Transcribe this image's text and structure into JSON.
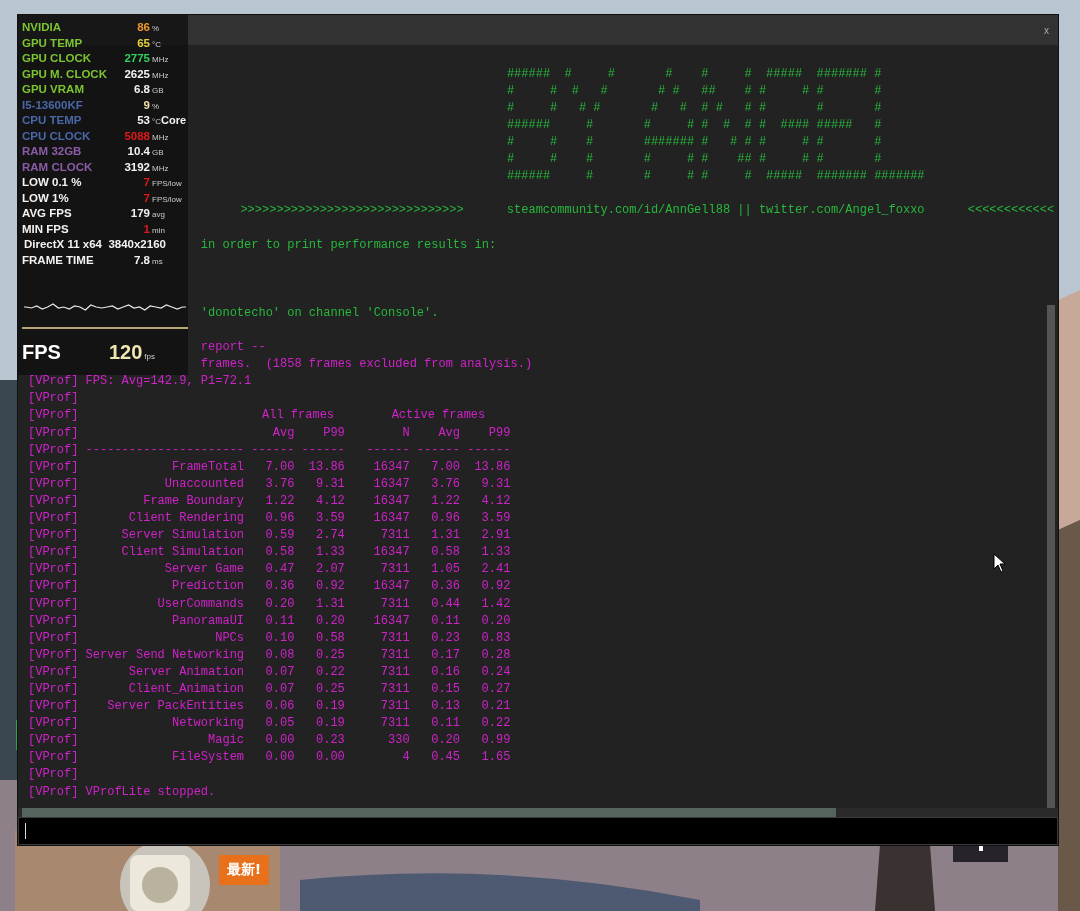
{
  "window": {
    "close": "x"
  },
  "console_lines": [
    {
      "kind": "gap"
    },
    {
      "kind": "art",
      "text": "######  #     #       #    #     #  #####  ####### #"
    },
    {
      "kind": "art",
      "text": "#     #  #   #       # #   ##    # #     # #       #"
    },
    {
      "kind": "art",
      "text": "#     #   # #       #   #  # #   # #       #       #"
    },
    {
      "kind": "art",
      "text": "######     #       #     # #  #  # #  #### #####   #"
    },
    {
      "kind": "art",
      "text": "#     #    #       ####### #   # # #     # #       #"
    },
    {
      "kind": "art",
      "text": "#     #    #       #     # #    ## #     # #       #"
    },
    {
      "kind": "art",
      "text": "######     #       #     # #     #  #####  ####### #######"
    },
    {
      "kind": "gap"
    },
    {
      "kind": "banner",
      "text": ">>>>>>>>>>>>>>>>>>>>>>>>>>>>>>>      steamcommunity.com/id/AnnGell88 || twitter.com/Angel_foxxo      <<<<<<<<<<<<"
    },
    {
      "kind": "gap"
    },
    {
      "kind": "covered",
      "text": "in order to print performance results in:"
    },
    {
      "kind": "gap"
    },
    {
      "kind": "gap"
    },
    {
      "kind": "gap"
    },
    {
      "kind": "covered",
      "text": "'donotecho' on channel 'Console'."
    }
  ],
  "vprof_lines": [
    {
      "kind": "gap"
    },
    {
      "kind": "covered",
      "text": "report --"
    },
    {
      "kind": "covered",
      "text": "frames.  (1858 frames excluded from analysis.)"
    },
    {
      "kind": "text",
      "channel": "[VProf]",
      "text": "FPS: Avg=142.9, P1=72.1"
    },
    {
      "kind": "blank",
      "channel": "[VProf]"
    },
    {
      "kind": "groups",
      "channel": "[VProf]",
      "all": "All frames",
      "active": "Active frames"
    },
    {
      "kind": "columns",
      "channel": "[VProf]",
      "cells": [
        "Avg",
        "P99",
        "N",
        "Avg",
        "P99"
      ]
    },
    {
      "kind": "rule",
      "channel": "[VProf]",
      "cells": [
        "----------------------",
        "------",
        "------",
        "------",
        "------",
        "------"
      ]
    },
    {
      "kind": "row",
      "channel": "[VProf]",
      "cells": [
        "FrameTotal",
        "7.00",
        "13.86",
        "16347",
        "7.00",
        "13.86"
      ]
    },
    {
      "kind": "row",
      "channel": "[VProf]",
      "cells": [
        "Unaccounted",
        "3.76",
        "9.31",
        "16347",
        "3.76",
        "9.31"
      ]
    },
    {
      "kind": "row",
      "channel": "[VProf]",
      "cells": [
        "Frame Boundary",
        "1.22",
        "4.12",
        "16347",
        "1.22",
        "4.12"
      ]
    },
    {
      "kind": "row",
      "channel": "[VProf]",
      "cells": [
        "Client Rendering",
        "0.96",
        "3.59",
        "16347",
        "0.96",
        "3.59"
      ]
    },
    {
      "kind": "row",
      "channel": "[VProf]",
      "cells": [
        "Server Simulation",
        "0.59",
        "2.74",
        "7311",
        "1.31",
        "2.91"
      ]
    },
    {
      "kind": "row",
      "channel": "[VProf]",
      "cells": [
        "Client Simulation",
        "0.58",
        "1.33",
        "16347",
        "0.58",
        "1.33"
      ]
    },
    {
      "kind": "row",
      "channel": "[VProf]",
      "cells": [
        "Server Game",
        "0.47",
        "2.07",
        "7311",
        "1.05",
        "2.41"
      ]
    },
    {
      "kind": "row",
      "channel": "[VProf]",
      "cells": [
        "Prediction",
        "0.36",
        "0.92",
        "16347",
        "0.36",
        "0.92"
      ]
    },
    {
      "kind": "row",
      "channel": "[VProf]",
      "cells": [
        "UserCommands",
        "0.20",
        "1.31",
        "7311",
        "0.44",
        "1.42"
      ]
    },
    {
      "kind": "row",
      "channel": "[VProf]",
      "cells": [
        "PanoramaUI",
        "0.11",
        "0.20",
        "16347",
        "0.11",
        "0.20"
      ]
    },
    {
      "kind": "row",
      "channel": "[VProf]",
      "cells": [
        "NPCs",
        "0.10",
        "0.58",
        "7311",
        "0.23",
        "0.83"
      ]
    },
    {
      "kind": "row",
      "channel": "[VProf]",
      "cells": [
        "Server Send Networking",
        "0.08",
        "0.25",
        "7311",
        "0.17",
        "0.28"
      ]
    },
    {
      "kind": "row",
      "channel": "[VProf]",
      "cells": [
        "Server Animation",
        "0.07",
        "0.22",
        "7311",
        "0.16",
        "0.24"
      ]
    },
    {
      "kind": "row",
      "channel": "[VProf]",
      "cells": [
        "Client_Animation",
        "0.07",
        "0.25",
        "7311",
        "0.15",
        "0.27"
      ]
    },
    {
      "kind": "row",
      "channel": "[VProf]",
      "cells": [
        "Server PackEntities",
        "0.06",
        "0.19",
        "7311",
        "0.13",
        "0.21"
      ]
    },
    {
      "kind": "row",
      "channel": "[VProf]",
      "cells": [
        "Networking",
        "0.05",
        "0.19",
        "7311",
        "0.11",
        "0.22"
      ]
    },
    {
      "kind": "row",
      "channel": "[VProf]",
      "cells": [
        "Magic",
        "0.00",
        "0.23",
        "330",
        "0.20",
        "0.99"
      ]
    },
    {
      "kind": "row",
      "channel": "[VProf]",
      "cells": [
        "FileSystem",
        "0.00",
        "0.00",
        "4",
        "0.45",
        "1.65"
      ]
    },
    {
      "kind": "blank",
      "channel": "[VProf]"
    },
    {
      "kind": "text",
      "channel": "[VProf]",
      "text": "VProfLite stopped."
    }
  ],
  "overlay": {
    "stats": [
      {
        "label": {
          "text": "NVIDIA",
          "color": "#7cc531"
        },
        "value": {
          "text": "86",
          "color": "#f0962a"
        },
        "unit": "%"
      },
      {
        "label": {
          "text": "GPU TEMP",
          "color": "#7cc531"
        },
        "value": {
          "text": "65",
          "color": "#e6d23a"
        },
        "unit": "°C"
      },
      {
        "label": {
          "text": "GPU CLOCK",
          "color": "#7cc531"
        },
        "value": {
          "text": "2775",
          "color": "#34d060"
        },
        "unit": "MHz"
      },
      {
        "label": {
          "text": "GPU M. CLOCK",
          "color": "#7cc531"
        },
        "value": {
          "text": "2625",
          "color": "#f2f2f2"
        },
        "unit": "MHz"
      },
      {
        "label": {
          "text": "GPU VRAM",
          "color": "#7cc531"
        },
        "value": {
          "text": "6.8",
          "color": "#f2f2f2"
        },
        "unit": "GB"
      },
      {
        "label": {
          "text": "I5-13600KF",
          "color": "#4a68a8"
        },
        "value": {
          "text": "9",
          "color": "#ece2a8"
        },
        "unit": "%"
      },
      {
        "label": {
          "text": "CPU TEMP",
          "color": "#4a68a8"
        },
        "value": {
          "text": "53",
          "color": "#f2f2f2"
        },
        "unit": "°C",
        "extra": "Core"
      },
      {
        "label": {
          "text": "CPU CLOCK",
          "color": "#4a68a8"
        },
        "value": {
          "text": "5088",
          "color": "#e01818"
        },
        "unit": "MHz"
      },
      {
        "label": {
          "text": "RAM 32GB",
          "color": "#8a5ca8"
        },
        "value": {
          "text": "10.4",
          "color": "#f2f2f2"
        },
        "unit": "GB"
      },
      {
        "label": {
          "text": "RAM CLOCK",
          "color": "#8a5ca8"
        },
        "value": {
          "text": "3192",
          "color": "#f2f2f2"
        },
        "unit": "MHz"
      },
      {
        "label": {
          "text": "LOW 0.1 %",
          "color": "#f2f2f2"
        },
        "value": {
          "text": "7",
          "color": "#e01818"
        },
        "unit": "FPS/low"
      },
      {
        "label": {
          "text": "LOW 1%",
          "color": "#f2f2f2"
        },
        "value": {
          "text": "7",
          "color": "#e01818"
        },
        "unit": "FPS/low"
      },
      {
        "label": {
          "text": "AVG FPS",
          "color": "#f2f2f2"
        },
        "value": {
          "text": "179",
          "color": "#f2f2f2"
        },
        "unit": "avg"
      },
      {
        "label": {
          "text": "MIN FPS",
          "color": "#f2f2f2"
        },
        "value": {
          "text": "1",
          "color": "#e01818"
        },
        "unit": "min"
      }
    ],
    "renderer": "DirectX 11 x64  3840x2160",
    "frame_time": {
      "label": "FRAME TIME",
      "value": "7.8",
      "unit": "ms"
    },
    "fps": {
      "label": "FPS",
      "value": "120",
      "unit": "fps"
    }
  },
  "badge": "最新!"
}
